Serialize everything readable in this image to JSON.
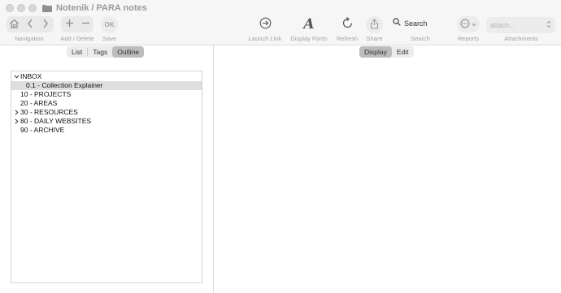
{
  "window": {
    "title": "Notenik / PARA notes"
  },
  "toolbar": {
    "navigation_label": "Navigation",
    "add_delete_label": "Add / Delete",
    "ok_text": "OK",
    "save_label": "Save",
    "launch_link_label": "Launch Link",
    "display_fonts_label": "Display Fonts",
    "refresh_label": "Refresh",
    "share_label": "Share",
    "search_button_text": "Search",
    "search_label": "Search",
    "reports_label": "Reports",
    "attachments_label": "Attachments",
    "attachments_placeholder": "attach..."
  },
  "left_tabs": {
    "items": [
      {
        "label": "List",
        "active": false
      },
      {
        "label": "Tags",
        "active": false
      },
      {
        "label": "Outline",
        "active": true
      }
    ]
  },
  "right_tabs": {
    "items": [
      {
        "label": "Display",
        "active": true
      },
      {
        "label": "Edit",
        "active": false
      }
    ]
  },
  "outline": {
    "items": [
      {
        "label": "INBOX",
        "disclosure": "expanded",
        "level": 0,
        "selected": false
      },
      {
        "label": "0.1 - Collection Explainer",
        "disclosure": "none",
        "level": 1,
        "selected": true
      },
      {
        "label": "10 - PROJECTS",
        "disclosure": "none",
        "level": 0,
        "selected": false
      },
      {
        "label": "20 - AREAS",
        "disclosure": "none",
        "level": 0,
        "selected": false
      },
      {
        "label": "30 - RESOURCES",
        "disclosure": "collapsed",
        "level": 0,
        "selected": false
      },
      {
        "label": "80 - DAILY WEBSITES",
        "disclosure": "collapsed",
        "level": 0,
        "selected": false
      },
      {
        "label": "90 - ARCHIVE",
        "disclosure": "none",
        "level": 0,
        "selected": false
      }
    ]
  },
  "colors": {
    "toolbar_bg": "#f6f6f6",
    "selection_bg": "#dedede",
    "active_tab_bg": "#bdbdbd",
    "muted_text": "#a3a3a3"
  },
  "icons": {
    "home": "home-icon",
    "back": "chevron-left-icon",
    "forward": "chevron-right-icon",
    "add": "plus-icon",
    "delete": "minus-icon",
    "launch_link": "arrow-circle-icon",
    "display_fonts": "font-a-icon",
    "refresh": "refresh-icon",
    "share": "share-icon",
    "search": "magnifier-icon",
    "reports": "ellipsis-circle-icon",
    "attachments": "up-down-chevron-icon",
    "folder": "folder-icon"
  }
}
